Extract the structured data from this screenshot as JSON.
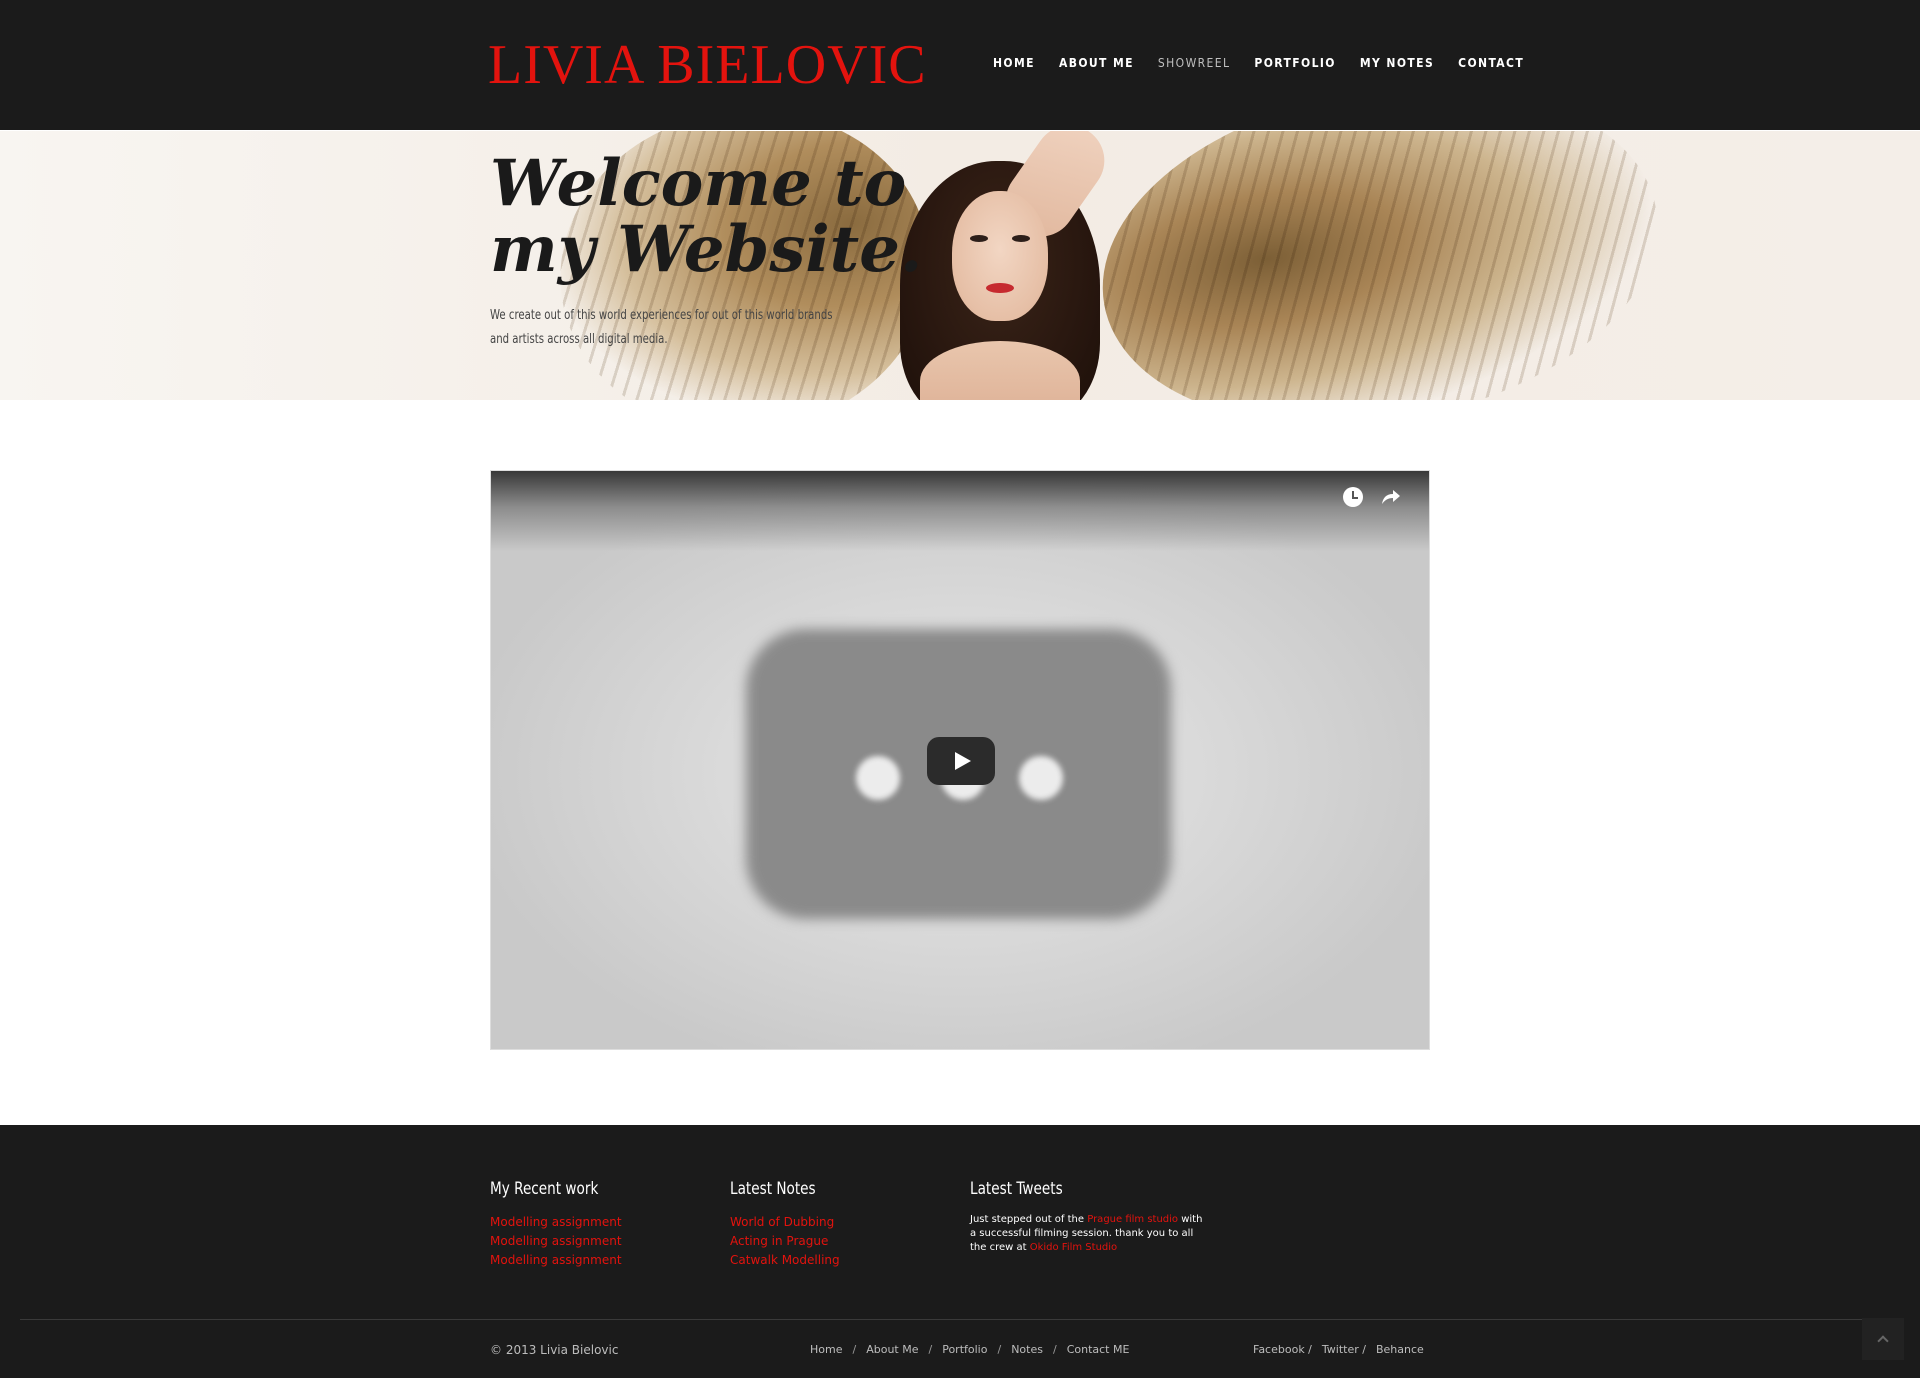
{
  "header": {
    "logo": "LIVIA BIELOVIC",
    "nav": [
      {
        "label": "HOME"
      },
      {
        "label": "ABOUT ME"
      },
      {
        "label": "SHOWREEL",
        "active": true
      },
      {
        "label": "PORTFOLIO"
      },
      {
        "label": "MY NOTES"
      },
      {
        "label": "CONTACT"
      }
    ]
  },
  "hero": {
    "title": "Welcome to my Website.",
    "subtitle": "We create out of this world experiences for out of this world brands and artists across all digital media."
  },
  "video": {
    "icons": [
      "clock-icon",
      "share-icon"
    ],
    "play_icon": "play-icon"
  },
  "footer": {
    "recent_work": {
      "heading": "My Recent work",
      "items": [
        "Modelling assignment",
        "Modelling assignment",
        "Modelling assignment"
      ]
    },
    "latest_notes": {
      "heading": "Latest Notes",
      "items": [
        "World of Dubbing",
        "Acting in Prague",
        "Catwalk Modelling"
      ]
    },
    "latest_tweets": {
      "heading": "Latest Tweets",
      "text_1": "Just stepped out of the ",
      "link_1": "Prague film studio",
      "text_2": " with a successful filming session. thank you to all the crew at ",
      "link_2": "Okido Film Studio"
    },
    "copyright": "© 2013 Livia Bielovic",
    "nav": [
      "Home",
      "About Me",
      "Portfolio",
      "Notes",
      "Contact ME"
    ],
    "separator": "/",
    "social": [
      "Facebook /",
      "Twitter /",
      "Behance"
    ]
  },
  "colors": {
    "accent": "#e3130e",
    "header_bg": "#1b1b1b",
    "footer_bg": "#1b1b1b"
  }
}
